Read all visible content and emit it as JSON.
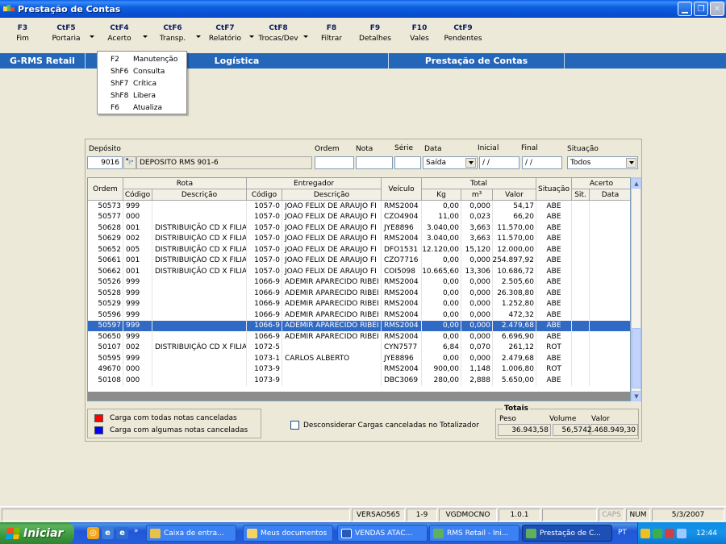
{
  "window": {
    "title": "Prestação de Contas"
  },
  "toolbar": [
    {
      "key": "F3",
      "label": "Fim"
    },
    {
      "key": "CtF5",
      "label": "Portaria"
    },
    {
      "key": "CtF4",
      "label": "Acerto"
    },
    {
      "key": "CtF6",
      "label": "Transp."
    },
    {
      "key": "CtF7",
      "label": "Relatório"
    },
    {
      "key": "CtF8",
      "label": "Trocas/Dev"
    },
    {
      "key": "F8",
      "label": "Filtrar"
    },
    {
      "key": "F9",
      "label": "Detalhes"
    },
    {
      "key": "F10",
      "label": "Vales"
    },
    {
      "key": "CtF9",
      "label": "Pendentes"
    }
  ],
  "band": {
    "app": "G-RMS Retail",
    "module": "Logística",
    "screen": "Prestação de Contas"
  },
  "menu": [
    {
      "key": "F2",
      "label": "Manutenção"
    },
    {
      "key": "ShF6",
      "label": "Consulta"
    },
    {
      "key": "ShF7",
      "label": "Crítica"
    },
    {
      "key": "ShF8",
      "label": "Libera"
    },
    {
      "key": "F6",
      "label": "Atualiza"
    }
  ],
  "filters": {
    "deposito_label": "Depósito",
    "deposito_code": "9016",
    "deposito_name": "DEPOSITO RMS 901-6",
    "ordem_label": "Ordem",
    "ordem_value": "",
    "nota_label": "Nota",
    "nota_value": "",
    "serie_label": "Série",
    "serie_value": "",
    "data_label": "Data",
    "data_value": "Saída",
    "inicial_label": "Inicial",
    "inicial_value": "/ /",
    "final_label": "Final",
    "final_value": "/ /",
    "situacao_label": "Situação",
    "situacao_value": "Todos"
  },
  "grid": {
    "group_headers": {
      "rota": "Rota",
      "entregador": "Entregador",
      "total": "Total",
      "acerto": "Acerto"
    },
    "headers": {
      "ordem": "Ordem",
      "rota_codigo": "Código",
      "rota_desc": "Descrição",
      "ent_codigo": "Código",
      "ent_desc": "Descrição",
      "veiculo": "Veículo",
      "kg": "Kg",
      "m3": "m³",
      "valor": "Valor",
      "situacao": "Situação",
      "sit": "Sit.",
      "data": "Data"
    },
    "rows": [
      [
        "50573",
        "999",
        "",
        "1057-0",
        "JOAO FELIX DE ARAUJO FI",
        "RMS2004",
        "0,00",
        "0,000",
        "54,17",
        "ABE",
        "",
        ""
      ],
      [
        "50577",
        "000",
        "",
        "1057-0",
        "JOAO FELIX DE ARAUJO FI",
        "CZO4904",
        "11,00",
        "0,023",
        "66,20",
        "ABE",
        "",
        ""
      ],
      [
        "50628",
        "001",
        "DISTRIBUIÇÃO CD X FILIA",
        "1057-0",
        "JOAO FELIX DE ARAUJO FI",
        "JYE8896",
        "3.040,00",
        "3,663",
        "11.570,00",
        "ABE",
        "",
        ""
      ],
      [
        "50629",
        "002",
        "DISTRIBUIÇÃO CD X FILIA",
        "1057-0",
        "JOAO FELIX DE ARAUJO FI",
        "RMS2004",
        "3.040,00",
        "3,663",
        "11.570,00",
        "ABE",
        "",
        ""
      ],
      [
        "50652",
        "005",
        "DISTRIBUIÇÃO CD X FILIA",
        "1057-0",
        "JOAO FELIX DE ARAUJO FI",
        "DFO1531",
        "12.120,00",
        "15,120",
        "12.000,00",
        "ABE",
        "",
        ""
      ],
      [
        "50661",
        "001",
        "DISTRIBUIÇÃO CD X FILIA",
        "1057-0",
        "JOAO FELIX DE ARAUJO FI",
        "CZO7716",
        "0,00",
        "0,000",
        "254.897,92",
        "ABE",
        "",
        ""
      ],
      [
        "50662",
        "001",
        "DISTRIBUIÇÃO CD X FILIA",
        "1057-0",
        "JOAO FELIX DE ARAUJO FI",
        "COI5098",
        "10.665,60",
        "13,306",
        "10.686,72",
        "ABE",
        "",
        ""
      ],
      [
        "50526",
        "999",
        "",
        "1066-9",
        "ADEMIR APARECIDO RIBEI",
        "RMS2004",
        "0,00",
        "0,000",
        "2.505,60",
        "ABE",
        "",
        ""
      ],
      [
        "50528",
        "999",
        "",
        "1066-9",
        "ADEMIR APARECIDO RIBEI",
        "RMS2004",
        "0,00",
        "0,000",
        "26.308,80",
        "ABE",
        "",
        ""
      ],
      [
        "50529",
        "999",
        "",
        "1066-9",
        "ADEMIR APARECIDO RIBEI",
        "RMS2004",
        "0,00",
        "0,000",
        "1.252,80",
        "ABE",
        "",
        ""
      ],
      [
        "50596",
        "999",
        "",
        "1066-9",
        "ADEMIR APARECIDO RIBEI",
        "RMS2004",
        "0,00",
        "0,000",
        "472,32",
        "ABE",
        "",
        ""
      ],
      [
        "50597",
        "999",
        "",
        "1066-9",
        "ADEMIR APARECIDO RIBEI",
        "RMS2004",
        "0,00",
        "0,000",
        "2.479,68",
        "ABE",
        "",
        ""
      ],
      [
        "50650",
        "999",
        "",
        "1066-9",
        "ADEMIR APARECIDO RIBEI",
        "RMS2004",
        "0,00",
        "0,000",
        "6.696,90",
        "ABE",
        "",
        ""
      ],
      [
        "50107",
        "002",
        "DISTRIBUIÇÃO CD X FILIA",
        "1072-5",
        "",
        "CYN7577",
        "6,84",
        "0,070",
        "261,12",
        "ROT",
        "",
        ""
      ],
      [
        "50595",
        "999",
        "",
        "1073-1",
        "CARLOS ALBERTO",
        "JYE8896",
        "0,00",
        "0,000",
        "2.479,68",
        "ABE",
        "",
        ""
      ],
      [
        "49670",
        "000",
        "",
        "1073-9",
        "",
        "RMS2004",
        "900,00",
        "1,148",
        "1.006,80",
        "ROT",
        "",
        ""
      ],
      [
        "50108",
        "000",
        "",
        "1073-9",
        "",
        "DBC3069",
        "280,00",
        "2,888",
        "5.650,00",
        "ABE",
        "",
        ""
      ]
    ],
    "selected_row": 11
  },
  "legend": [
    {
      "color": "#ff0000",
      "label": "Carga com todas notas canceladas"
    },
    {
      "color": "#0000ff",
      "label": "Carga com algumas notas canceladas"
    }
  ],
  "checkbox": {
    "label": "Desconsiderar Cargas canceladas no Totalizador",
    "checked": false
  },
  "totals": {
    "title": "Totais",
    "peso_label": "Peso",
    "peso": "36.943,58",
    "volume_label": "Volume",
    "volume": "56,574",
    "valor_label": "Valor",
    "valor": "2.468.949,30"
  },
  "statusbar": {
    "versao": "VERSAO565",
    "sep": "1-9",
    "user": "VGDMOCNO",
    "build": "1.0.1",
    "caps": "CAPS",
    "num": "NUM",
    "date": "5/3/2007"
  },
  "taskbar": {
    "start": "Iniciar",
    "tasks": [
      "Caixa de entra...",
      "Meus documentos",
      "VENDAS ATAC...",
      "RMS Retail - Ini...",
      "Prestação de C..."
    ],
    "lang": "PT",
    "clock": "12:44"
  },
  "colors": {
    "titlebar": "#0b5fe0",
    "band": "#2466b8",
    "selection": "#316ac5",
    "taskbar": "#245edb"
  }
}
